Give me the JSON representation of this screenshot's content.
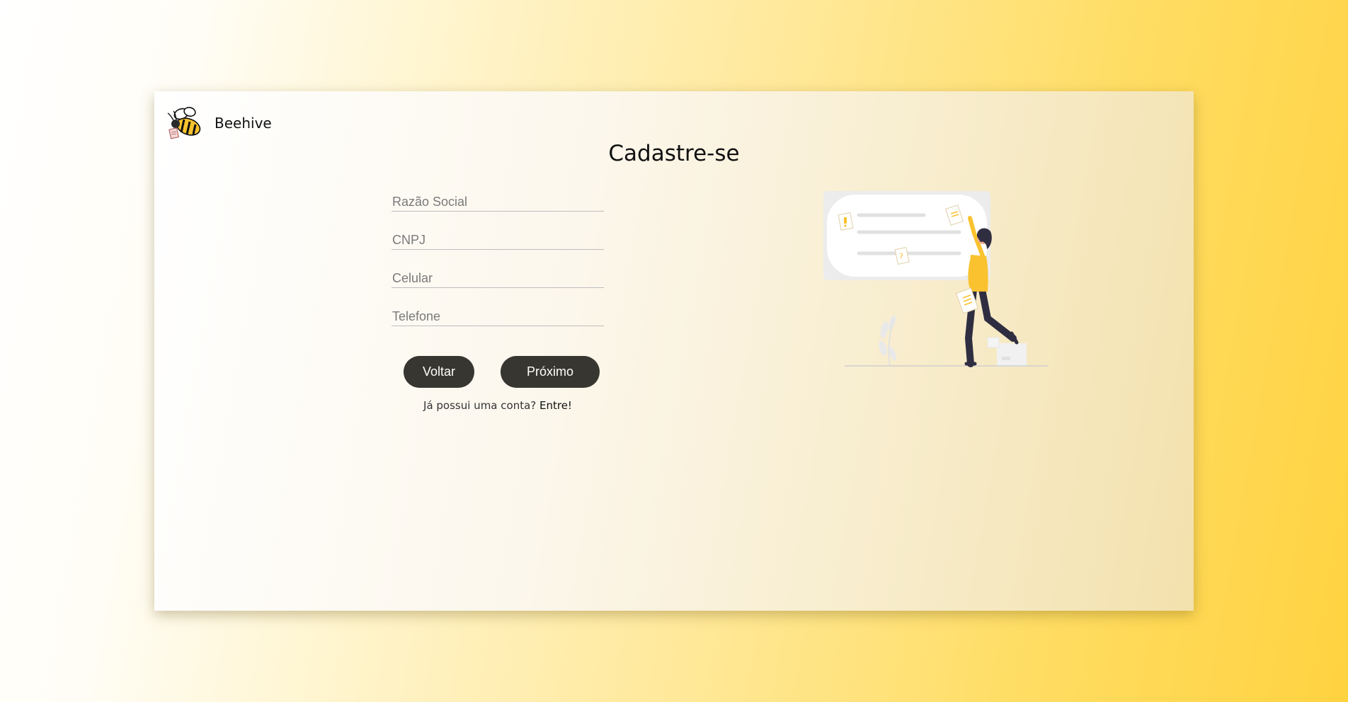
{
  "brand": {
    "name": "Beehive",
    "logo_icon": "bee-logo-icon"
  },
  "page_title": "Cadastre-se",
  "form": {
    "fields": [
      {
        "name": "razao-social",
        "placeholder": "Razão Social",
        "value": ""
      },
      {
        "name": "cnpj",
        "placeholder": "CNPJ",
        "value": ""
      },
      {
        "name": "celular",
        "placeholder": "Celular",
        "value": ""
      },
      {
        "name": "telefone",
        "placeholder": "Telefone",
        "value": ""
      }
    ],
    "back_label": "Voltar",
    "next_label": "Próximo"
  },
  "login_prompt": {
    "text": "Já possui uma conta? ",
    "link_label": "Entre!"
  },
  "illustration_icon": "woman-organizing-notes-illustration",
  "colors": {
    "accent": "#F9C22E",
    "button_bg": "#383630",
    "button_text": "#ffffff",
    "text": "#111111"
  }
}
